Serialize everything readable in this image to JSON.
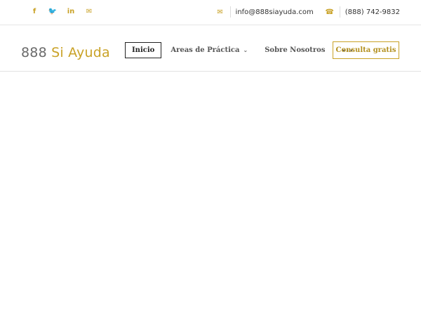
{
  "topbar": {
    "social": [
      {
        "icon": "facebook-icon",
        "glyph": "f"
      },
      {
        "icon": "twitter-icon",
        "glyph": "🐦"
      },
      {
        "icon": "linkedin-icon",
        "glyph": "in"
      },
      {
        "icon": "mail-icon",
        "glyph": "✉"
      }
    ],
    "email": "info@888siayuda.com",
    "phone": "(888) 742-9832",
    "email_icon_glyph": "✉",
    "phone_icon_glyph": "☎"
  },
  "header": {
    "logo_number": "888",
    "logo_brand": "Si Ayuda",
    "nav": {
      "home": "Inicio",
      "areas": "Areas de Práctica",
      "areas_chevron": "⌄",
      "about": "Sobre Nosotros",
      "more": "···"
    },
    "cta": "Consulta gratis"
  },
  "colors": {
    "accent": "#c9a227",
    "text": "#333333",
    "divider": "#e2e2e2"
  }
}
